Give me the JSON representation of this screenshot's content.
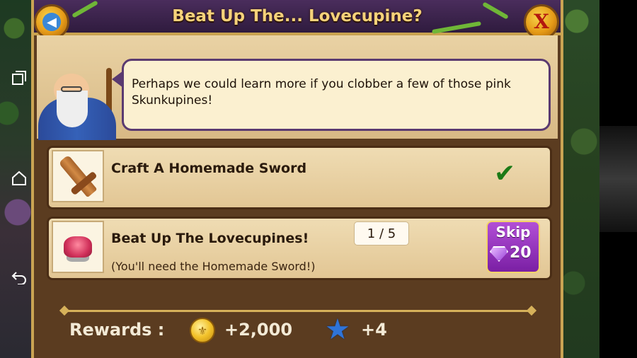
{
  "header": {
    "title": "Beat Up The... Lovecupine?",
    "back_icon": "arrow-left-icon",
    "close_label": "X"
  },
  "dialogue": {
    "text": "Perhaps we could learn more if you clobber a few of those pink Skunkupines!"
  },
  "quests": [
    {
      "title": "Craft A Homemade Sword",
      "status": "completed",
      "icon": "wooden-sword-icon"
    },
    {
      "title": "Beat Up The Lovecupines!",
      "subtitle": "(You'll need the Homemade Sword!)",
      "progress": "1 / 5",
      "icon": "lovecupine-icon",
      "skip": {
        "label": "Skip",
        "cost": "20",
        "icon": "gem-icon"
      }
    }
  ],
  "rewards": {
    "label": "Rewards :",
    "coins": "+2,000",
    "stars": "+4"
  },
  "colors": {
    "title_text": "#f6d27a",
    "panel_brown": "#5b3c20",
    "parchment": "#efdcb3",
    "skip_purple": "#7a1fa4",
    "check_green": "#1c7a16"
  }
}
